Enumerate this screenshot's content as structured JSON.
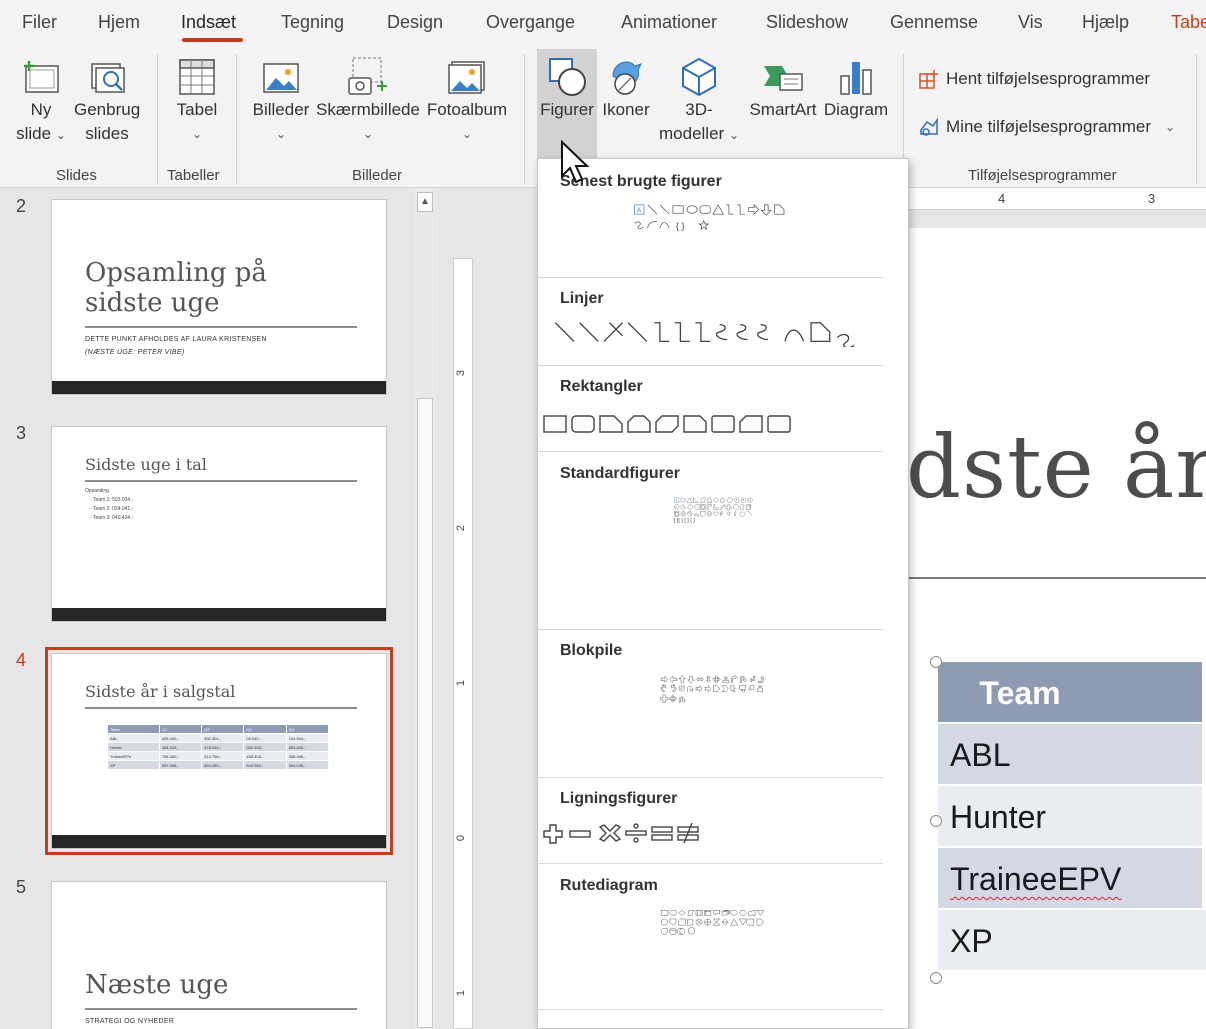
{
  "ribbon": {
    "tabs": [
      "Filer",
      "Hjem",
      "Indsæt",
      "Tegning",
      "Design",
      "Overgange",
      "Animationer",
      "Slideshow",
      "Gennemse",
      "Vis",
      "Hjælp",
      "Tabe"
    ],
    "active_tab": "Indsæt",
    "buttons": {
      "ny_slide": [
        "Ny",
        "slide"
      ],
      "genbrug": [
        "Genbrug",
        "slides"
      ],
      "tabel": "Tabel",
      "billeder": "Billeder",
      "skaermbillede": "Skærmbillede",
      "fotoalbum": "Fotoalbum",
      "figurer": "Figurer",
      "ikoner": "Ikoner",
      "modeller": [
        "3D-",
        "modeller"
      ],
      "smartart": "SmartArt",
      "diagram": "Diagram",
      "hent": "Hent tilføjelsesprogrammer",
      "mine": "Mine tilføjelsesprogrammer"
    },
    "groups": {
      "slides": "Slides",
      "tabeller": "Tabeller",
      "billeder": "Billeder",
      "tilfoj": "Tilføjelsesprogrammer"
    },
    "accent": "#c43e1c"
  },
  "thumbnails": {
    "slides": [
      {
        "number": "2",
        "title_lines": [
          "Opsamling på",
          "sidste uge"
        ],
        "lines": [
          "DETTE PUNKT AFHOLDES AF LAURA KRISTENSEN",
          "(NÆSTE UGE: PETER VIBE)"
        ]
      },
      {
        "number": "3",
        "title": "Sidste uge i tal",
        "lines": [
          "Opsamling",
          "- Team 1: 503.034,-",
          "- Team 2: 034.041,-",
          "- Team 3: 040.434,-"
        ]
      },
      {
        "number": "4",
        "title": "Sidste år i salgstal",
        "table": [
          [
            "Team",
            "Q1",
            "Q2",
            "Q3",
            "Q4"
          ],
          [
            "ABL",
            "405.400,-",
            "450.304,-",
            "05.540,-",
            "104.504,-"
          ],
          [
            "Hunter",
            "384.043,-",
            "478.044,-",
            "000.403,-",
            "853.840,-"
          ],
          [
            "TraineeEPV",
            "758.450,-",
            "310.758,-",
            "458.403,-",
            "458.456,-"
          ],
          [
            "XP",
            "557.458,-",
            "854.450,-",
            "644.546,-",
            "354.045,-"
          ]
        ]
      },
      {
        "number": "5",
        "title": "Næste uge",
        "lines": [
          "STRATEGI OG NYHEDER"
        ]
      }
    ]
  },
  "ruler": {
    "horizontal": [
      "4",
      "3"
    ],
    "vertical": [
      "3",
      "2",
      "1",
      "0",
      "1"
    ]
  },
  "main_slide": {
    "title_fragment": "dste år",
    "table": {
      "header": "Team",
      "rows": [
        "ABL",
        "Hunter",
        "TraineeEPV",
        "XP"
      ]
    }
  },
  "shapes_menu": {
    "sections": [
      {
        "id": "recent",
        "title": "Senest brugte figurer"
      },
      {
        "id": "linjer",
        "title": "Linjer"
      },
      {
        "id": "rekt",
        "title": "Rektangler"
      },
      {
        "id": "std",
        "title": "Standardfigurer"
      },
      {
        "id": "blok",
        "title": "Blokpile"
      },
      {
        "id": "lign",
        "title": "Ligningsfigurer"
      },
      {
        "id": "rute",
        "title": "Rutediagram"
      }
    ]
  }
}
